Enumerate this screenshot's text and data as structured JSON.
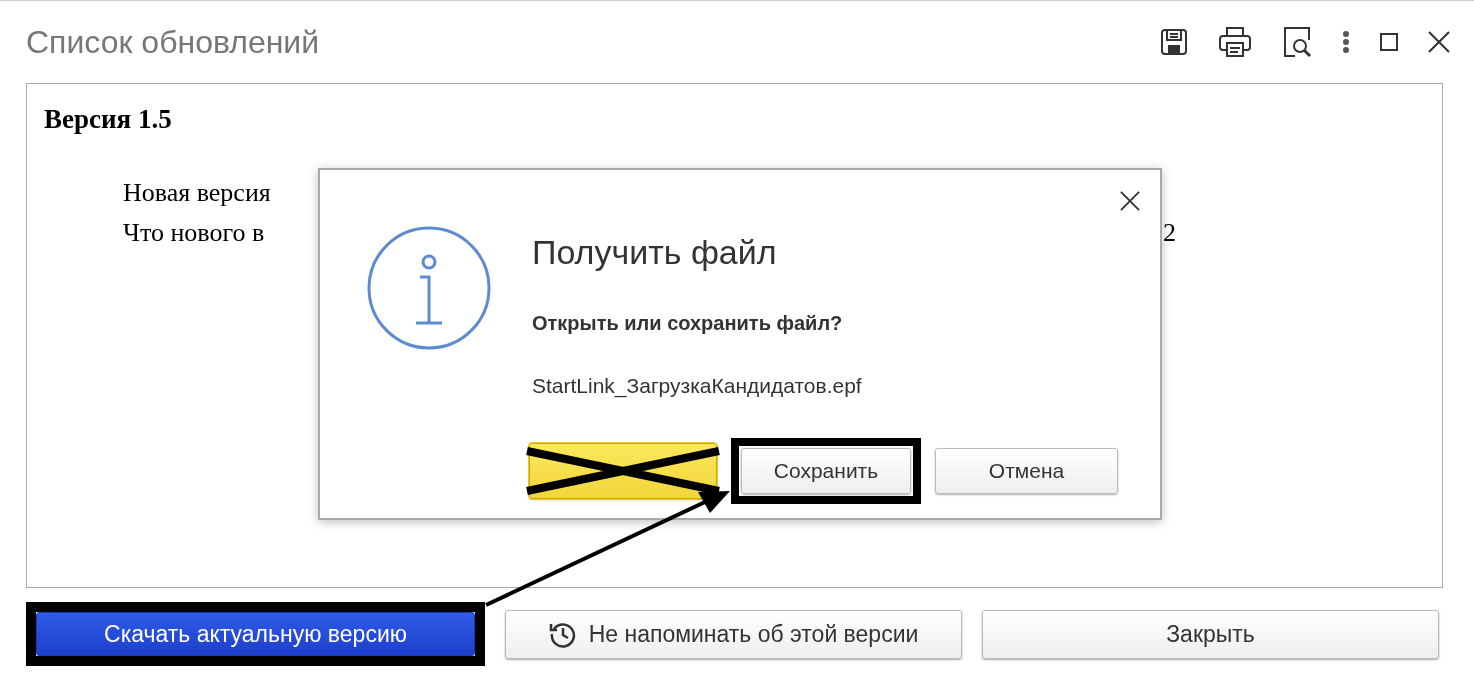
{
  "window": {
    "title": "Список обновлений"
  },
  "toolbar": [
    {
      "kind": "save"
    },
    {
      "kind": "print"
    },
    {
      "kind": "preview"
    },
    {
      "kind": "more"
    },
    {
      "kind": "maximize"
    },
    {
      "kind": "close"
    }
  ],
  "content": {
    "heading": "Версия 1.5",
    "lines": [
      {
        "text": "Новая версия"
      },
      {
        "text": "Что нового в",
        "tail": "2"
      }
    ]
  },
  "dialog": {
    "title": "Получить файл",
    "question": "Открыть или сохранить файл?",
    "filename": "StartLink_ЗагрузкаКандидатов.epf",
    "buttons": [
      {
        "kind": "default",
        "crossed_out": true,
        "highlighted": false
      },
      {
        "kind": "normal",
        "label": "Сохранить",
        "crossed_out": false,
        "highlighted": true
      },
      {
        "kind": "normal",
        "label": "Отмена",
        "crossed_out": false,
        "highlighted": false
      }
    ]
  },
  "buttons": [
    {
      "kind": "primary",
      "label": "Скачать актуальную версию",
      "highlighted": true
    },
    {
      "kind": "history",
      "label": "Не напоминать об этой версии",
      "highlighted": false
    },
    {
      "kind": "normal",
      "label": "Закрыть",
      "highlighted": false
    }
  ],
  "annotation": {
    "arrow": true
  }
}
